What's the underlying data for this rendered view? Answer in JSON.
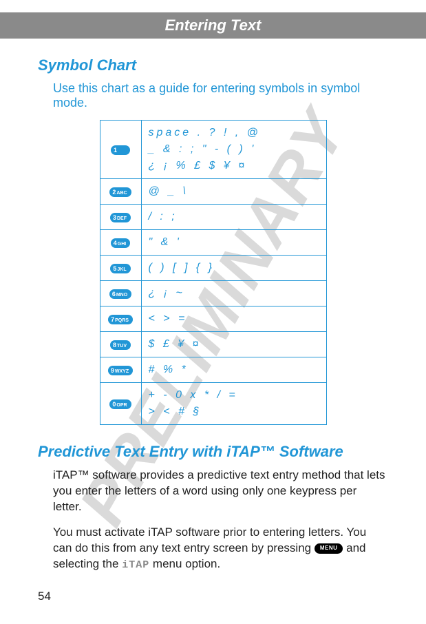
{
  "watermark": "PRELIMINARY",
  "header": "Entering Text",
  "section1": {
    "title": "Symbol Chart",
    "intro": "Use this chart as a guide for entering symbols in symbol mode."
  },
  "keys": {
    "k1": {
      "num": "1",
      "sub": ""
    },
    "k2": {
      "num": "2",
      "sub": "ABC"
    },
    "k3": {
      "num": "3",
      "sub": "DEF"
    },
    "k4": {
      "num": "4",
      "sub": "GHI"
    },
    "k5": {
      "num": "5",
      "sub": "JKL"
    },
    "k6": {
      "num": "6",
      "sub": "MNO"
    },
    "k7": {
      "num": "7",
      "sub": "PQRS"
    },
    "k8": {
      "num": "8",
      "sub": "TUV"
    },
    "k9": {
      "num": "9",
      "sub": "WXYZ"
    },
    "k0": {
      "num": "0",
      "sub": "OPR"
    }
  },
  "symbols": {
    "r1": "space . ? ! , @\n_ & : ; \" - ( ) '\n¿ ¡ % £ $ ¥ ¤",
    "r2": "@ _ \\",
    "r3": "/ : ;",
    "r4": "\" & '",
    "r5": "( ) [ ] { }",
    "r6": "¿ ¡ ~",
    "r7": "< > =",
    "r8": "$ £ ¥ ¤",
    "r9": "# % *",
    "r0": "+ - 0 x * / =\n> < # §"
  },
  "section2": {
    "title": "Predictive Text Entry with iTAP™ Software",
    "para1_a": "iTAP™ software provides a predictive text entry method that lets you enter the letters of a word using only one keypress per letter.",
    "para2_a": "You must activate iTAP software prior to entering letters. You can do this from any text entry screen by pressing ",
    "menu_label": "MENU",
    "para2_b": " and selecting the ",
    "itap_label": "iTAP",
    "para2_c": " menu option."
  },
  "page_number": "54"
}
